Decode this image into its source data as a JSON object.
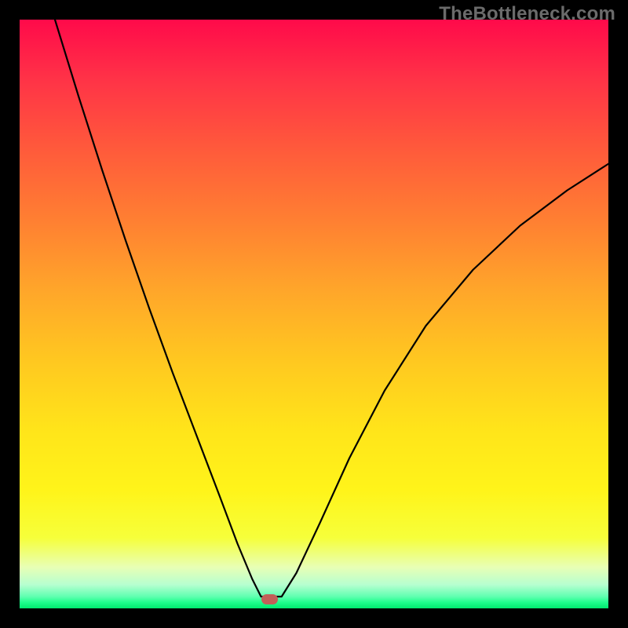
{
  "watermark": "TheBottleneck.com",
  "chart_data": {
    "type": "line",
    "title": "",
    "xlabel": "",
    "ylabel": "",
    "xlim": [
      0,
      1
    ],
    "ylim": [
      0,
      1
    ],
    "annotations": [
      {
        "name": "minimum-marker",
        "x": 0.425,
        "y": 0.015,
        "color": "#c26058",
        "shape": "pill"
      }
    ],
    "background_gradient": {
      "direction": "vertical",
      "stops": [
        {
          "pos": 0.0,
          "color": "#ff0a4a"
        },
        {
          "pos": 0.1,
          "color": "#ff3247"
        },
        {
          "pos": 0.22,
          "color": "#ff5a3b"
        },
        {
          "pos": 0.34,
          "color": "#ff7f32"
        },
        {
          "pos": 0.46,
          "color": "#ffa62a"
        },
        {
          "pos": 0.58,
          "color": "#ffc820"
        },
        {
          "pos": 0.7,
          "color": "#ffe51a"
        },
        {
          "pos": 0.8,
          "color": "#fff41a"
        },
        {
          "pos": 0.88,
          "color": "#f6ff3a"
        },
        {
          "pos": 0.93,
          "color": "#e8ffb5"
        },
        {
          "pos": 0.96,
          "color": "#b6ffd0"
        },
        {
          "pos": 0.98,
          "color": "#5fffb0"
        },
        {
          "pos": 0.99,
          "color": "#1eff8c"
        },
        {
          "pos": 1.0,
          "color": "#00e96e"
        }
      ]
    },
    "series": [
      {
        "name": "left-branch",
        "x": [
          0.06,
          0.1,
          0.14,
          0.18,
          0.22,
          0.26,
          0.3,
          0.34,
          0.37,
          0.395,
          0.41
        ],
        "y": [
          1.0,
          0.87,
          0.745,
          0.625,
          0.51,
          0.4,
          0.295,
          0.19,
          0.11,
          0.05,
          0.02
        ]
      },
      {
        "name": "valley-floor",
        "x": [
          0.41,
          0.445
        ],
        "y": [
          0.02,
          0.02
        ]
      },
      {
        "name": "right-branch",
        "x": [
          0.445,
          0.47,
          0.51,
          0.56,
          0.62,
          0.69,
          0.77,
          0.85,
          0.93,
          1.0
        ],
        "y": [
          0.02,
          0.06,
          0.145,
          0.255,
          0.37,
          0.48,
          0.575,
          0.65,
          0.71,
          0.755
        ]
      }
    ]
  }
}
